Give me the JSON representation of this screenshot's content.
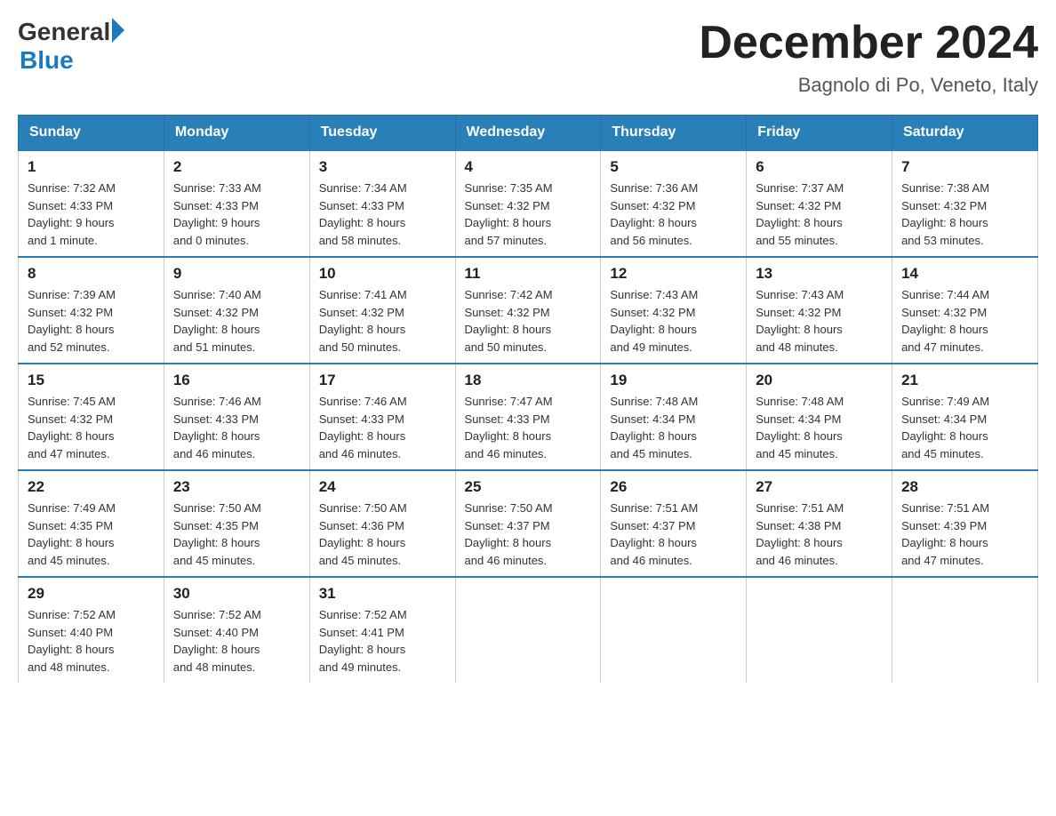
{
  "header": {
    "month_year": "December 2024",
    "location": "Bagnolo di Po, Veneto, Italy"
  },
  "logo": {
    "general": "General",
    "blue": "Blue"
  },
  "days_of_week": [
    "Sunday",
    "Monday",
    "Tuesday",
    "Wednesday",
    "Thursday",
    "Friday",
    "Saturday"
  ],
  "weeks": [
    [
      {
        "day": "1",
        "sunrise": "7:32 AM",
        "sunset": "4:33 PM",
        "daylight": "9 hours and 1 minute."
      },
      {
        "day": "2",
        "sunrise": "7:33 AM",
        "sunset": "4:33 PM",
        "daylight": "9 hours and 0 minutes."
      },
      {
        "day": "3",
        "sunrise": "7:34 AM",
        "sunset": "4:33 PM",
        "daylight": "8 hours and 58 minutes."
      },
      {
        "day": "4",
        "sunrise": "7:35 AM",
        "sunset": "4:32 PM",
        "daylight": "8 hours and 57 minutes."
      },
      {
        "day": "5",
        "sunrise": "7:36 AM",
        "sunset": "4:32 PM",
        "daylight": "8 hours and 56 minutes."
      },
      {
        "day": "6",
        "sunrise": "7:37 AM",
        "sunset": "4:32 PM",
        "daylight": "8 hours and 55 minutes."
      },
      {
        "day": "7",
        "sunrise": "7:38 AM",
        "sunset": "4:32 PM",
        "daylight": "8 hours and 53 minutes."
      }
    ],
    [
      {
        "day": "8",
        "sunrise": "7:39 AM",
        "sunset": "4:32 PM",
        "daylight": "8 hours and 52 minutes."
      },
      {
        "day": "9",
        "sunrise": "7:40 AM",
        "sunset": "4:32 PM",
        "daylight": "8 hours and 51 minutes."
      },
      {
        "day": "10",
        "sunrise": "7:41 AM",
        "sunset": "4:32 PM",
        "daylight": "8 hours and 50 minutes."
      },
      {
        "day": "11",
        "sunrise": "7:42 AM",
        "sunset": "4:32 PM",
        "daylight": "8 hours and 50 minutes."
      },
      {
        "day": "12",
        "sunrise": "7:43 AM",
        "sunset": "4:32 PM",
        "daylight": "8 hours and 49 minutes."
      },
      {
        "day": "13",
        "sunrise": "7:43 AM",
        "sunset": "4:32 PM",
        "daylight": "8 hours and 48 minutes."
      },
      {
        "day": "14",
        "sunrise": "7:44 AM",
        "sunset": "4:32 PM",
        "daylight": "8 hours and 47 minutes."
      }
    ],
    [
      {
        "day": "15",
        "sunrise": "7:45 AM",
        "sunset": "4:32 PM",
        "daylight": "8 hours and 47 minutes."
      },
      {
        "day": "16",
        "sunrise": "7:46 AM",
        "sunset": "4:33 PM",
        "daylight": "8 hours and 46 minutes."
      },
      {
        "day": "17",
        "sunrise": "7:46 AM",
        "sunset": "4:33 PM",
        "daylight": "8 hours and 46 minutes."
      },
      {
        "day": "18",
        "sunrise": "7:47 AM",
        "sunset": "4:33 PM",
        "daylight": "8 hours and 46 minutes."
      },
      {
        "day": "19",
        "sunrise": "7:48 AM",
        "sunset": "4:34 PM",
        "daylight": "8 hours and 45 minutes."
      },
      {
        "day": "20",
        "sunrise": "7:48 AM",
        "sunset": "4:34 PM",
        "daylight": "8 hours and 45 minutes."
      },
      {
        "day": "21",
        "sunrise": "7:49 AM",
        "sunset": "4:34 PM",
        "daylight": "8 hours and 45 minutes."
      }
    ],
    [
      {
        "day": "22",
        "sunrise": "7:49 AM",
        "sunset": "4:35 PM",
        "daylight": "8 hours and 45 minutes."
      },
      {
        "day": "23",
        "sunrise": "7:50 AM",
        "sunset": "4:35 PM",
        "daylight": "8 hours and 45 minutes."
      },
      {
        "day": "24",
        "sunrise": "7:50 AM",
        "sunset": "4:36 PM",
        "daylight": "8 hours and 45 minutes."
      },
      {
        "day": "25",
        "sunrise": "7:50 AM",
        "sunset": "4:37 PM",
        "daylight": "8 hours and 46 minutes."
      },
      {
        "day": "26",
        "sunrise": "7:51 AM",
        "sunset": "4:37 PM",
        "daylight": "8 hours and 46 minutes."
      },
      {
        "day": "27",
        "sunrise": "7:51 AM",
        "sunset": "4:38 PM",
        "daylight": "8 hours and 46 minutes."
      },
      {
        "day": "28",
        "sunrise": "7:51 AM",
        "sunset": "4:39 PM",
        "daylight": "8 hours and 47 minutes."
      }
    ],
    [
      {
        "day": "29",
        "sunrise": "7:52 AM",
        "sunset": "4:40 PM",
        "daylight": "8 hours and 48 minutes."
      },
      {
        "day": "30",
        "sunrise": "7:52 AM",
        "sunset": "4:40 PM",
        "daylight": "8 hours and 48 minutes."
      },
      {
        "day": "31",
        "sunrise": "7:52 AM",
        "sunset": "4:41 PM",
        "daylight": "8 hours and 49 minutes."
      },
      null,
      null,
      null,
      null
    ]
  ]
}
